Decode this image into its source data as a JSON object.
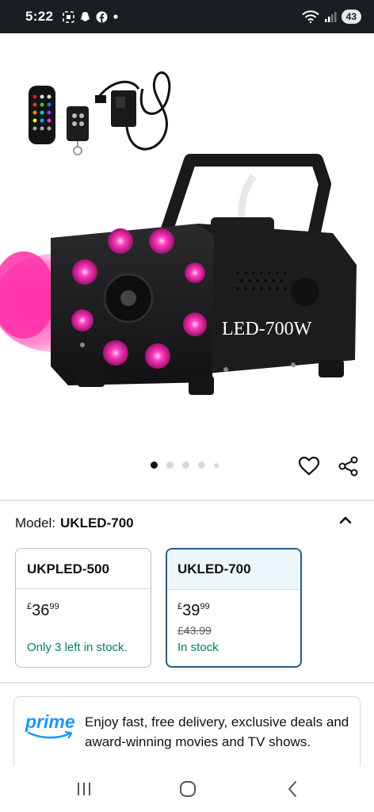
{
  "status_bar": {
    "time": "5:22",
    "left_icons": [
      "screenshot-icon",
      "snapchat-icon",
      "facebook-icon",
      "dot-icon"
    ],
    "right_icons": [
      "wifi-icon",
      "signal-icon"
    ],
    "battery": "43"
  },
  "product": {
    "image_label": "LED-700W",
    "image_count": 5,
    "active_image_index": 0
  },
  "model": {
    "label": "Model:",
    "value": "UKLED-700"
  },
  "variants": [
    {
      "name": "UKPLED-500",
      "price_symbol": "£",
      "price_whole": "36",
      "price_fraction": "99",
      "old_price": "",
      "stock": "Only 3 left in stock.",
      "selected": false
    },
    {
      "name": "UKLED-700",
      "price_symbol": "£",
      "price_whole": "39",
      "price_fraction": "99",
      "old_price": "£43.99",
      "stock": "In stock",
      "selected": true
    }
  ],
  "prime": {
    "logo_text": "prime",
    "message": "Enjoy fast, free delivery, exclusive deals and award-winning movies and TV shows."
  },
  "colors": {
    "status_bar_bg": "#1a1d21",
    "stock_green": "#067d62",
    "selected_border": "#2a5b84",
    "prime_blue": "#1a98ff",
    "fog_pink": "#ff2fa8"
  }
}
